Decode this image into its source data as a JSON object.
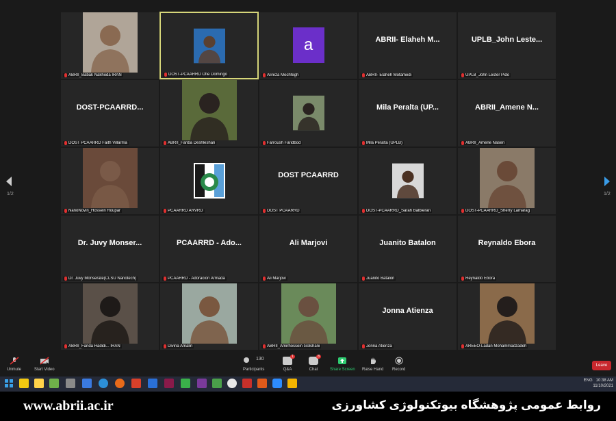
{
  "participants": [
    {
      "name": "ABRII_Babak Nakhoda IRAN",
      "type": "photo",
      "tone": "#8a6a52",
      "bg": "#b0a598"
    },
    {
      "name": "DOST-PCAARRD Ofie Domingo",
      "type": "photo-small",
      "tone": "#5a4030",
      "bg": "#2b6bb0",
      "active": true
    },
    {
      "name": "Alireza Mochfegh",
      "type": "letter",
      "letter": "a"
    },
    {
      "name": "ABRII- Elaheh Motamedi",
      "type": "text",
      "display": "ABRII- Elaheh M..."
    },
    {
      "name": "UPLB_John Lester Pido",
      "type": "text",
      "display": "UPLB_John Leste..."
    },
    {
      "name": "DOST PCAARRD Faith Villarma",
      "type": "text",
      "display": "DOST-PCAARRD..."
    },
    {
      "name": "ABRII_Fariba Deshleshan",
      "type": "photo",
      "tone": "#2a2320",
      "bg": "#5a6a3a"
    },
    {
      "name": "Farroush Faridbod",
      "type": "photo-small",
      "tone": "#2a2320",
      "bg": "#7a8a6a"
    },
    {
      "name": "Mila Peralta (UPLB)",
      "type": "text",
      "display": "Mila Peralta (UP..."
    },
    {
      "name": "ABRII_Amene Naseri",
      "type": "text",
      "display": "ABRII_Amene N..."
    },
    {
      "name": "NanoNovin_Hossein Roupar",
      "type": "photo",
      "tone": "#7a5a48",
      "bg": "#6a4a3a"
    },
    {
      "name": "PCAARRD ARVRD",
      "type": "logo"
    },
    {
      "name": "DOST PCAARRD",
      "type": "text",
      "display": "DOST PCAARRD"
    },
    {
      "name": "DOST-PCAARRD_Sarah Balbieran",
      "type": "photo-small",
      "tone": "#4a3022",
      "bg": "#d8d8d8"
    },
    {
      "name": "DOST-PCAARRD_Sherry Lamarag",
      "type": "photo",
      "tone": "#6a4a38",
      "bg": "#8a7a68"
    },
    {
      "name": "Dr. Juvy Monserate(CLSU Nanotech)",
      "type": "text",
      "display": "Dr. Juvy Monser..."
    },
    {
      "name": "PCAARRD - Adoracion Armada",
      "type": "text",
      "display": "PCAARRD - Ado..."
    },
    {
      "name": "Ali Marjovi",
      "type": "text",
      "display": "Ali Marjovi"
    },
    {
      "name": "Juanito Batalon",
      "type": "text",
      "display": "Juanito Batalon"
    },
    {
      "name": "Reynaldo Ebora",
      "type": "text",
      "display": "Reynaldo Ebora"
    },
    {
      "name": "ABRII_Farida Hadidi... IRAN",
      "type": "photo",
      "tone": "#1e1a18",
      "bg": "#5a5048"
    },
    {
      "name": "Divina Amalin",
      "type": "photo",
      "tone": "#7a5840",
      "bg": "#9aa8a0"
    },
    {
      "name": "ABRII_Amirhossein Golshani",
      "type": "photo",
      "tone": "#6a5040",
      "bg": "#6a8a5a"
    },
    {
      "name": "Jonna Atienza",
      "type": "text",
      "display": "Jonna Atienza"
    },
    {
      "name": "AREEO-Ladan Mohammadzadeh",
      "type": "photo",
      "tone": "#241e1c",
      "bg": "#8a6a4a"
    }
  ],
  "pagination": {
    "left": "1/2",
    "right": "1/2"
  },
  "toolbar": {
    "unmute": "Unmute",
    "start_video": "Start Video",
    "participants": "Participants",
    "participant_count": "130",
    "qa": "Q&A",
    "qa_badge": "1",
    "chat": "Chat",
    "chat_badge": "8",
    "share": "Share Screen",
    "raise": "Raise Hand",
    "record": "Record",
    "leave": "Leave"
  },
  "taskbar": {
    "lang": "ENG",
    "time": "10:38 AM",
    "date": "11/10/2021"
  },
  "banner": {
    "url": "www.abrii.ac.ir",
    "persian": "روابط عمومی پژوهشگاه بیوتکنولوژی کشاورزی"
  },
  "colors": {
    "accent_green": "#2ecc71",
    "mic_red": "#e03030",
    "leave_red": "#c8282e"
  }
}
